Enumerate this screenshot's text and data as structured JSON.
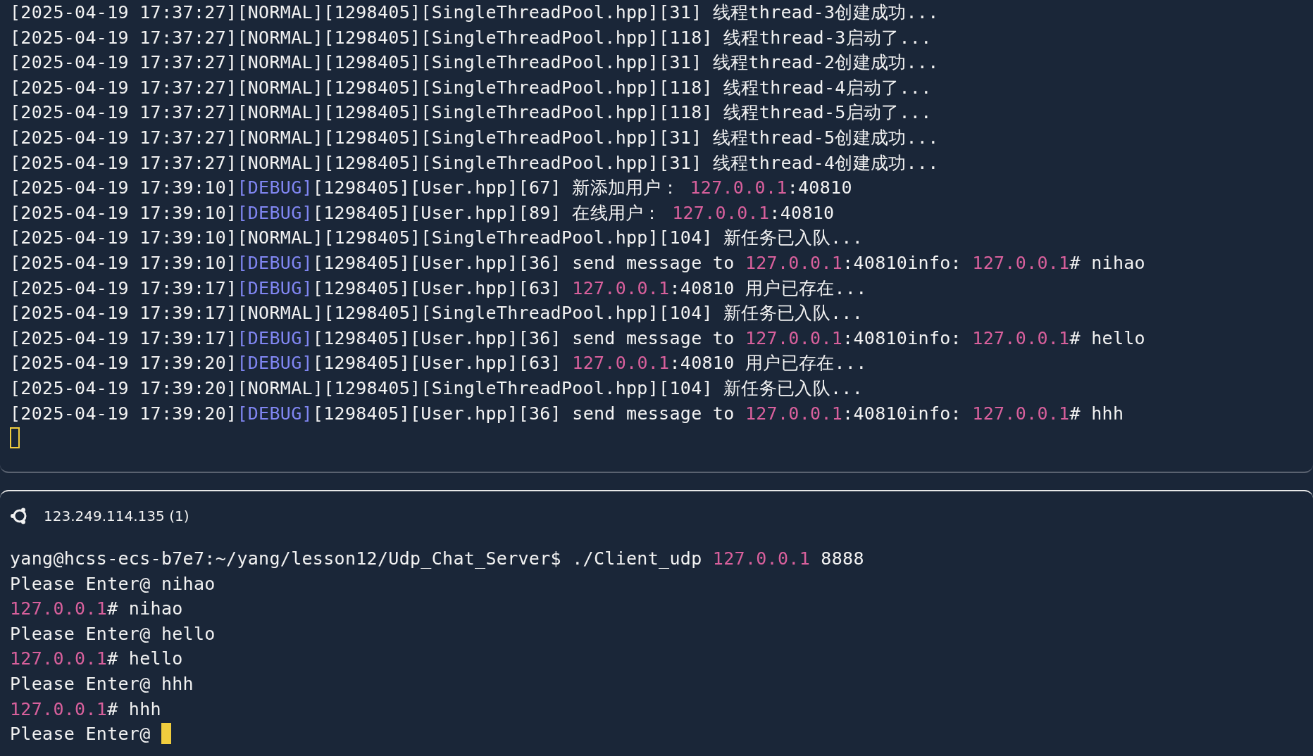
{
  "top_pane": {
    "focused": false,
    "lines": [
      {
        "segments": [
          {
            "kind": "plain",
            "text": "[2025-04-19 17:37:27][NORMAL][1298405][SingleThreadPool.hpp][31] 线程thread-3创建成功..."
          }
        ]
      },
      {
        "segments": [
          {
            "kind": "plain",
            "text": "[2025-04-19 17:37:27][NORMAL][1298405][SingleThreadPool.hpp][118] 线程thread-3启动了..."
          }
        ]
      },
      {
        "segments": [
          {
            "kind": "plain",
            "text": "[2025-04-19 17:37:27][NORMAL][1298405][SingleThreadPool.hpp][31] 线程thread-2创建成功..."
          }
        ]
      },
      {
        "segments": [
          {
            "kind": "plain",
            "text": "[2025-04-19 17:37:27][NORMAL][1298405][SingleThreadPool.hpp][118] 线程thread-4启动了..."
          }
        ]
      },
      {
        "segments": [
          {
            "kind": "plain",
            "text": "[2025-04-19 17:37:27][NORMAL][1298405][SingleThreadPool.hpp][118] 线程thread-5启动了..."
          }
        ]
      },
      {
        "segments": [
          {
            "kind": "plain",
            "text": "[2025-04-19 17:37:27][NORMAL][1298405][SingleThreadPool.hpp][31] 线程thread-5创建成功..."
          }
        ]
      },
      {
        "segments": [
          {
            "kind": "plain",
            "text": "[2025-04-19 17:37:27][NORMAL][1298405][SingleThreadPool.hpp][31] 线程thread-4创建成功..."
          }
        ]
      },
      {
        "segments": [
          {
            "kind": "plain",
            "text": "[2025-04-19 17:39:10]"
          },
          {
            "kind": "level",
            "text": "[DEBUG]"
          },
          {
            "kind": "plain",
            "text": "[1298405][User.hpp][67] 新添加用户： "
          },
          {
            "kind": "ip",
            "text": "127.0.0.1"
          },
          {
            "kind": "plain",
            "text": ":40810"
          }
        ]
      },
      {
        "segments": [
          {
            "kind": "plain",
            "text": "[2025-04-19 17:39:10]"
          },
          {
            "kind": "level",
            "text": "[DEBUG]"
          },
          {
            "kind": "plain",
            "text": "[1298405][User.hpp][89] 在线用户： "
          },
          {
            "kind": "ip",
            "text": "127.0.0.1"
          },
          {
            "kind": "plain",
            "text": ":40810"
          }
        ]
      },
      {
        "segments": [
          {
            "kind": "plain",
            "text": "[2025-04-19 17:39:10][NORMAL][1298405][SingleThreadPool.hpp][104] 新任务已入队..."
          }
        ]
      },
      {
        "segments": [
          {
            "kind": "plain",
            "text": "[2025-04-19 17:39:10]"
          },
          {
            "kind": "level",
            "text": "[DEBUG]"
          },
          {
            "kind": "plain",
            "text": "[1298405][User.hpp][36] send message to "
          },
          {
            "kind": "ip",
            "text": "127.0.0.1"
          },
          {
            "kind": "plain",
            "text": ":40810info: "
          },
          {
            "kind": "ip",
            "text": "127.0.0.1"
          },
          {
            "kind": "plain",
            "text": "# nihao"
          }
        ]
      },
      {
        "segments": [
          {
            "kind": "plain",
            "text": "[2025-04-19 17:39:17]"
          },
          {
            "kind": "level",
            "text": "[DEBUG]"
          },
          {
            "kind": "plain",
            "text": "[1298405][User.hpp][63] "
          },
          {
            "kind": "ip",
            "text": "127.0.0.1"
          },
          {
            "kind": "plain",
            "text": ":40810 用户已存在..."
          }
        ]
      },
      {
        "segments": [
          {
            "kind": "plain",
            "text": "[2025-04-19 17:39:17][NORMAL][1298405][SingleThreadPool.hpp][104] 新任务已入队..."
          }
        ]
      },
      {
        "segments": [
          {
            "kind": "plain",
            "text": "[2025-04-19 17:39:17]"
          },
          {
            "kind": "level",
            "text": "[DEBUG]"
          },
          {
            "kind": "plain",
            "text": "[1298405][User.hpp][36] send message to "
          },
          {
            "kind": "ip",
            "text": "127.0.0.1"
          },
          {
            "kind": "plain",
            "text": ":40810info: "
          },
          {
            "kind": "ip",
            "text": "127.0.0.1"
          },
          {
            "kind": "plain",
            "text": "# hello"
          }
        ]
      },
      {
        "segments": [
          {
            "kind": "plain",
            "text": "[2025-04-19 17:39:20]"
          },
          {
            "kind": "level",
            "text": "[DEBUG]"
          },
          {
            "kind": "plain",
            "text": "[1298405][User.hpp][63] "
          },
          {
            "kind": "ip",
            "text": "127.0.0.1"
          },
          {
            "kind": "plain",
            "text": ":40810 用户已存在..."
          }
        ]
      },
      {
        "segments": [
          {
            "kind": "plain",
            "text": "[2025-04-19 17:39:20][NORMAL][1298405][SingleThreadPool.hpp][104] 新任务已入队..."
          }
        ]
      },
      {
        "segments": [
          {
            "kind": "plain",
            "text": "[2025-04-19 17:39:20]"
          },
          {
            "kind": "level",
            "text": "[DEBUG]"
          },
          {
            "kind": "plain",
            "text": "[1298405][User.hpp][36] send message to "
          },
          {
            "kind": "ip",
            "text": "127.0.0.1"
          },
          {
            "kind": "plain",
            "text": ":40810info: "
          },
          {
            "kind": "ip",
            "text": "127.0.0.1"
          },
          {
            "kind": "plain",
            "text": "# hhh"
          }
        ]
      }
    ]
  },
  "bottom_pane": {
    "focused": true,
    "tab": {
      "title": "123.249.114.135 (1)"
    },
    "lines": [
      {
        "segments": [
          {
            "kind": "plain",
            "text": "yang@hcss-ecs-b7e7:~/yang/lesson12/Udp_Chat_Server$ ./Client_udp "
          },
          {
            "kind": "ip",
            "text": "127.0.0.1"
          },
          {
            "kind": "plain",
            "text": " 8888"
          }
        ]
      },
      {
        "segments": [
          {
            "kind": "plain",
            "text": "Please Enter@ nihao"
          }
        ]
      },
      {
        "segments": [
          {
            "kind": "ip",
            "text": "127.0.0.1"
          },
          {
            "kind": "plain",
            "text": "# nihao"
          }
        ]
      },
      {
        "segments": [
          {
            "kind": "plain",
            "text": "Please Enter@ hello"
          }
        ]
      },
      {
        "segments": [
          {
            "kind": "ip",
            "text": "127.0.0.1"
          },
          {
            "kind": "plain",
            "text": "# hello"
          }
        ]
      },
      {
        "segments": [
          {
            "kind": "plain",
            "text": "Please Enter@ hhh"
          }
        ]
      },
      {
        "segments": [
          {
            "kind": "ip",
            "text": "127.0.0.1"
          },
          {
            "kind": "plain",
            "text": "# hhh"
          }
        ]
      },
      {
        "segments": [
          {
            "kind": "plain",
            "text": "Please Enter@ "
          }
        ]
      }
    ]
  }
}
